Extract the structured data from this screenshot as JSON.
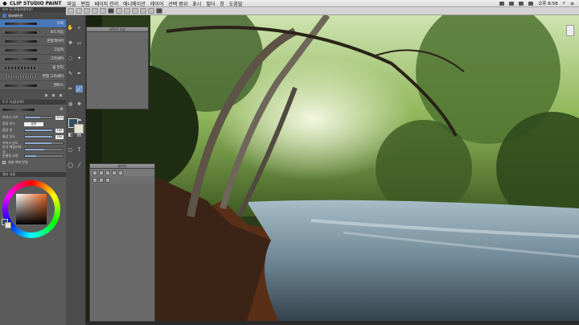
{
  "menubar": {
    "app_name": "CLIP STUDIO PAINT",
    "items": [
      "파일",
      "편집",
      "페이지 관리",
      "애니메이션",
      "레이어",
      "선택 범위",
      "표시",
      "필터",
      "창",
      "도움말"
    ],
    "clock": "오후 8:58"
  },
  "left_panel": {
    "sub_tool_title": "보조 도구[데코레이션]",
    "brush_group_label": "데코레이션",
    "brushes": [
      {
        "label": "유화",
        "selected": true
      },
      {
        "label": "보드저음",
        "selected": false
      },
      {
        "label": "혼합레이어",
        "selected": false
      },
      {
        "label": "그림자",
        "selected": false
      },
      {
        "label": "그리세어",
        "selected": false
      },
      {
        "label": "물 번지",
        "selected": false
      },
      {
        "label": "연필 그리세어",
        "selected": false
      },
      {
        "label": "캔버스",
        "selected": false
      }
    ],
    "tool_property_title": "도구 속성[유화]",
    "properties": [
      {
        "label": "브러시 크기",
        "value": "25.0",
        "fill": 0.55
      },
      {
        "label": "합성 모드",
        "value": "표준",
        "fill": 0.0
      },
      {
        "label": "물감 양",
        "value": "100",
        "fill": 1.0
      },
      {
        "label": "물감 농도",
        "value": "100",
        "fill": 1.0
      },
      {
        "label": "브러시 농도",
        "value": "",
        "fill": 0.7
      },
      {
        "label": "안티 에일리어싱",
        "value": "",
        "fill": 0.5
      },
      {
        "label": "손떨림 보정",
        "value": "",
        "fill": 0.3
      }
    ],
    "checkbox_label": "원래 색에 반영",
    "color_panel_title": "컬러 서클"
  },
  "colors": {
    "main_color": "#2f4e5e",
    "sub_color": "#eae2d0",
    "selected_brush": "#4a78b8"
  },
  "panels": {
    "top_panel_title": "레이어 속성",
    "bottom_panel_title": "레이어"
  },
  "icons": [
    "hand-icon",
    "zoom-icon",
    "move-icon",
    "select-icon",
    "lasso-icon",
    "wand-icon",
    "eyedropper-icon",
    "pen-icon",
    "pencil-icon",
    "brush-icon",
    "airbrush-icon",
    "decoration-icon",
    "eraser-icon",
    "blend-icon",
    "fill-icon",
    "gradient-icon",
    "figure-icon",
    "text-icon",
    "balloon-icon",
    "ruler-icon"
  ]
}
